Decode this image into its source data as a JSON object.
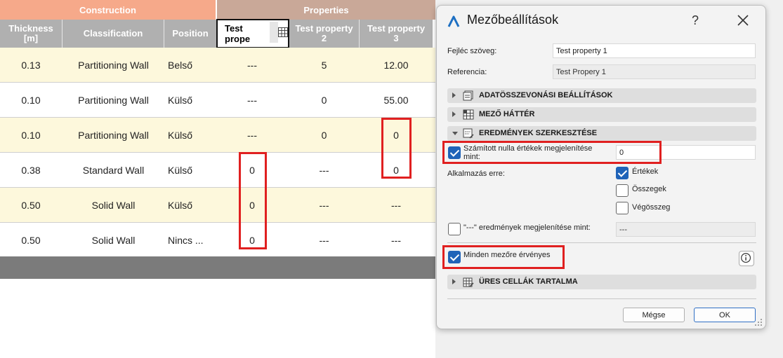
{
  "table": {
    "groups": {
      "construction": "Construction",
      "properties": "Properties"
    },
    "headers": {
      "thickness": "Thickness\n[m]",
      "classification": "Classification",
      "position": "Position",
      "tp1_edit": "Test\nprope",
      "tp2": "Test property\n2",
      "tp3": "Test property\n3"
    },
    "rows": [
      [
        "0.13",
        "Partitioning Wall",
        "Belső",
        "---",
        "5",
        "12.00"
      ],
      [
        "0.10",
        "Partitioning Wall",
        "Külső",
        "---",
        "0",
        "55.00"
      ],
      [
        "0.10",
        "Partitioning Wall",
        "Külső",
        "---",
        "0",
        "0"
      ],
      [
        "0.38",
        "Standard Wall",
        "Külső",
        "0",
        "---",
        "0"
      ],
      [
        "0.50",
        "Solid Wall",
        "Külső",
        "0",
        "---",
        "---"
      ],
      [
        "0.50",
        "Solid Wall",
        "Nincs ...",
        "0",
        "---",
        "---"
      ]
    ]
  },
  "dialog": {
    "title": "Mezőbeállítások",
    "help": "?",
    "header_label": "Fejléc szöveg:",
    "header_value": "Test property 1",
    "ref_label": "Referencia:",
    "ref_value": "Test Propery 1",
    "sections": {
      "data": "ADATÖSSZEVONÁSI BEÁLLÍTÁSOK",
      "bg": "MEZŐ HÁTTÉR",
      "results": "EREDMÉNYEK SZERKESZTÉSE",
      "empty": "ÜRES CELLÁK TARTALMA"
    },
    "zero_label": "Számított nulla értékek megjelenítése\nmint:",
    "zero_value": "0",
    "apply_label": "Alkalmazás erre:",
    "apply_values": "Értékek",
    "apply_sums": "Összegek",
    "apply_total": "Végösszeg",
    "dash_label": "\"---\" eredmények megjelenítése mint:",
    "dash_value": "---",
    "all_fields": "Minden mezőre érvényes",
    "cancel": "Mégse",
    "ok": "OK"
  },
  "colors": {
    "construction_header": "#f6a98a",
    "properties_header": "#c9a898",
    "column_header": "#b0b0b0",
    "row_highlight": "#fdf8dc",
    "highlight_box": "#e02020",
    "accent": "#1f63b8"
  }
}
